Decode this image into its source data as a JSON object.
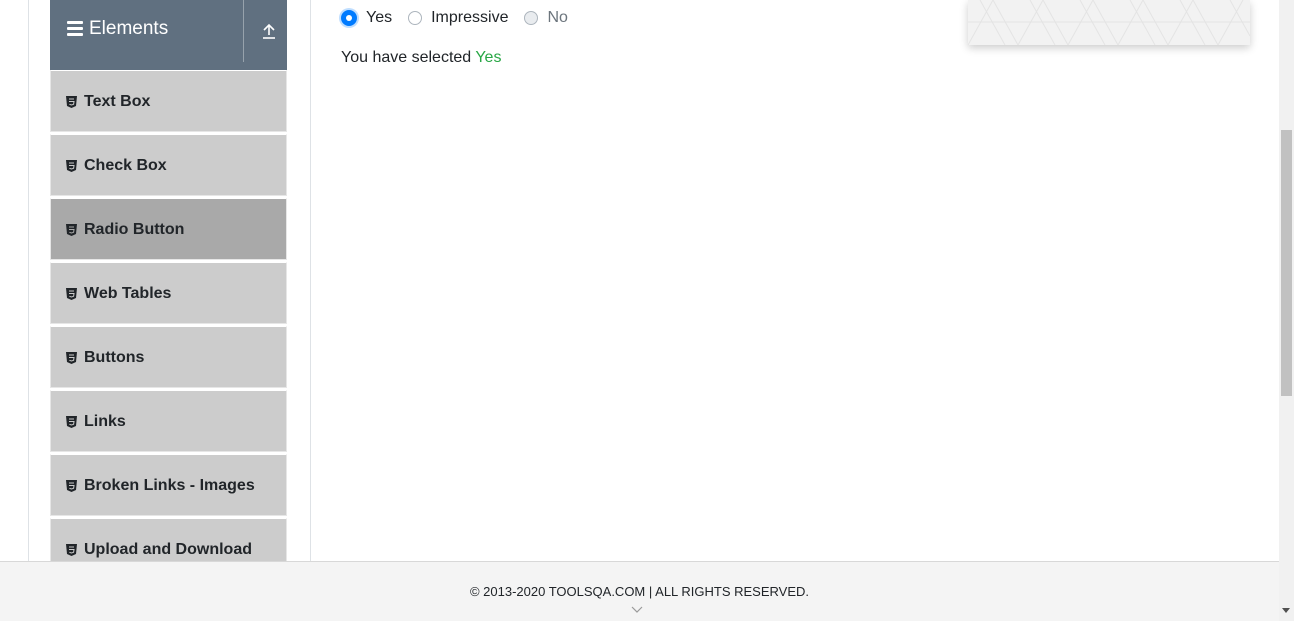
{
  "sidebar": {
    "group_title": "Elements",
    "group_icon": "hamburger-menu-icon",
    "collapse_icon": "collapse-up-icon",
    "items": [
      {
        "label": "Text Box",
        "icon": "html5-icon",
        "active": false
      },
      {
        "label": "Check Box",
        "icon": "html5-icon",
        "active": false
      },
      {
        "label": "Radio Button",
        "icon": "html5-icon",
        "active": true
      },
      {
        "label": "Web Tables",
        "icon": "html5-icon",
        "active": false
      },
      {
        "label": "Buttons",
        "icon": "html5-icon",
        "active": false
      },
      {
        "label": "Links",
        "icon": "html5-icon",
        "active": false
      },
      {
        "label": "Broken Links - Images",
        "icon": "html5-icon",
        "active": false
      },
      {
        "label": "Upload and Download",
        "icon": "html5-icon",
        "active": false
      }
    ]
  },
  "radio_group": {
    "options": [
      {
        "label": "Yes",
        "checked": true,
        "disabled": false
      },
      {
        "label": "Impressive",
        "checked": false,
        "disabled": false
      },
      {
        "label": "No",
        "checked": false,
        "disabled": true
      }
    ]
  },
  "result": {
    "prefix": "You have selected ",
    "value": "Yes"
  },
  "footer": {
    "copyright": "© 2013-2020 TOOLSQA.COM | ALL RIGHTS RESERVED."
  },
  "colors": {
    "header_bg": "#607080",
    "menu_item_bg": "#cccccc",
    "menu_item_active_bg": "#a9a9a9",
    "radio_checked": "#007bff",
    "success_text": "#28a745",
    "footer_bg": "#f4f4f4"
  }
}
